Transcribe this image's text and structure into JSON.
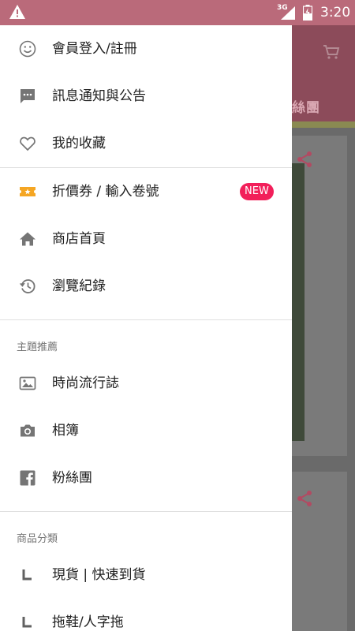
{
  "status_bar": {
    "network": "3G",
    "time": "3:20"
  },
  "background": {
    "title_fragment": "絲團",
    "accent": "#d9a7b2"
  },
  "drawer": {
    "account": [
      {
        "label": "會員登入/註冊",
        "icon": "smile-icon"
      },
      {
        "label": "訊息通知與公告",
        "icon": "message-icon"
      },
      {
        "label": "我的收藏",
        "icon": "heart-icon"
      }
    ],
    "shop": [
      {
        "label": "折價券 / 輸入卷號",
        "icon": "ticket-icon",
        "badge": "NEW"
      },
      {
        "label": "商店首頁",
        "icon": "home-icon"
      },
      {
        "label": "瀏覽紀錄",
        "icon": "history-icon"
      }
    ],
    "themes_header": "主題推薦",
    "themes": [
      {
        "label": "時尚流行誌",
        "icon": "image-icon"
      },
      {
        "label": "相簿",
        "icon": "camera-icon"
      },
      {
        "label": "粉絲團",
        "icon": "facebook-icon"
      }
    ],
    "categories_header": "商品分類",
    "categories": [
      {
        "label": "現貨 | 快速到貨",
        "icon": "subitem-icon"
      },
      {
        "label": "拖鞋/人字拖",
        "icon": "subitem-icon"
      }
    ]
  },
  "colors": {
    "status_bar": "#ba6a7a",
    "badge": "#f21f5a",
    "ticket": "#f5a623",
    "icon": "#757575"
  }
}
